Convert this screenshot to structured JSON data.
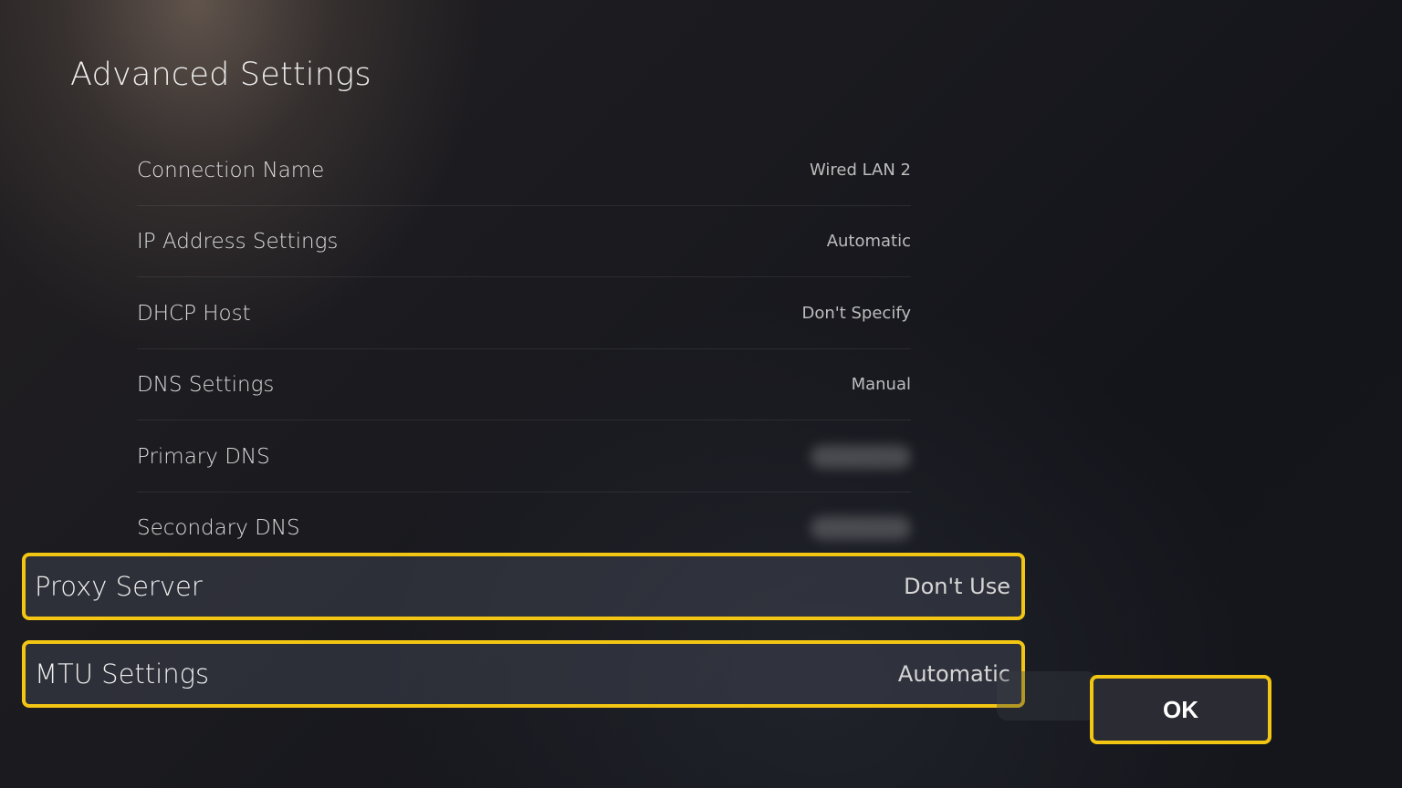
{
  "page": {
    "title": "Advanced Settings"
  },
  "settings": [
    {
      "id": "connection-name",
      "label": "Connection Name",
      "value": "Wired LAN 2"
    },
    {
      "id": "ip-address-settings",
      "label": "IP Address Settings",
      "value": "Automatic"
    },
    {
      "id": "dhcp-host",
      "label": "DHCP Host",
      "value": "Don't Specify"
    },
    {
      "id": "dns-settings",
      "label": "DNS Settings",
      "value": "Manual"
    },
    {
      "id": "primary-dns",
      "label": "Primary DNS",
      "value_hidden": true
    },
    {
      "id": "secondary-dns",
      "label": "Secondary DNS",
      "value_hidden": true
    },
    {
      "id": "proxy-server",
      "label": "Proxy Server",
      "value": "Don't Use",
      "highlighted": true
    },
    {
      "id": "mtu-settings",
      "label": "MTU Settings",
      "value": "Automatic",
      "highlighted": true
    }
  ],
  "ok_button": {
    "label": "OK",
    "highlighted": true
  },
  "colors": {
    "highlight": "#f3c613",
    "background": "#18181d"
  }
}
